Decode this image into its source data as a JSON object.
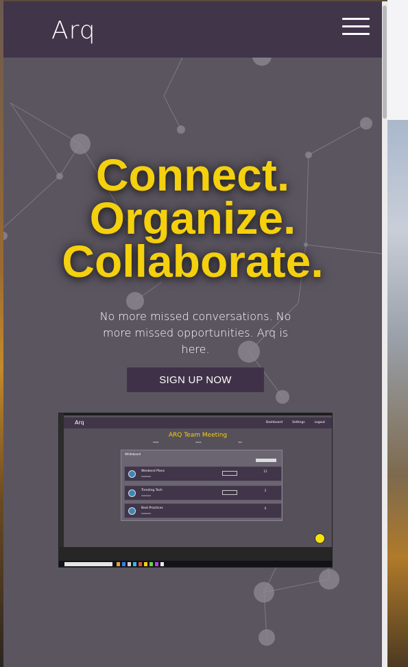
{
  "header": {
    "logo": "Arq",
    "menu_icon": "hamburger-menu-icon"
  },
  "hero": {
    "line1": "Connect.",
    "line2": "Organize.",
    "line3": "Collaborate."
  },
  "tagline": "No more missed conversations. No more missed opportunities. Arq is here.",
  "signup_label": "SIGN UP NOW",
  "colors": {
    "header_bg": "#41354a",
    "page_bg": "#5b5560",
    "accent_yellow": "#f4d00e",
    "button_bg": "#3f3248"
  },
  "preview": {
    "logo": "Arq",
    "nav": [
      "Dashboard",
      "Settings",
      "Logout"
    ],
    "title": "ARQ Team Meeting",
    "panel_title": "Whiteboard",
    "rows": [
      {
        "name": "Weekend Plans",
        "count": "11"
      },
      {
        "name": "Trending Tech",
        "count": "2"
      },
      {
        "name": "Best Practices",
        "count": "0"
      }
    ]
  }
}
